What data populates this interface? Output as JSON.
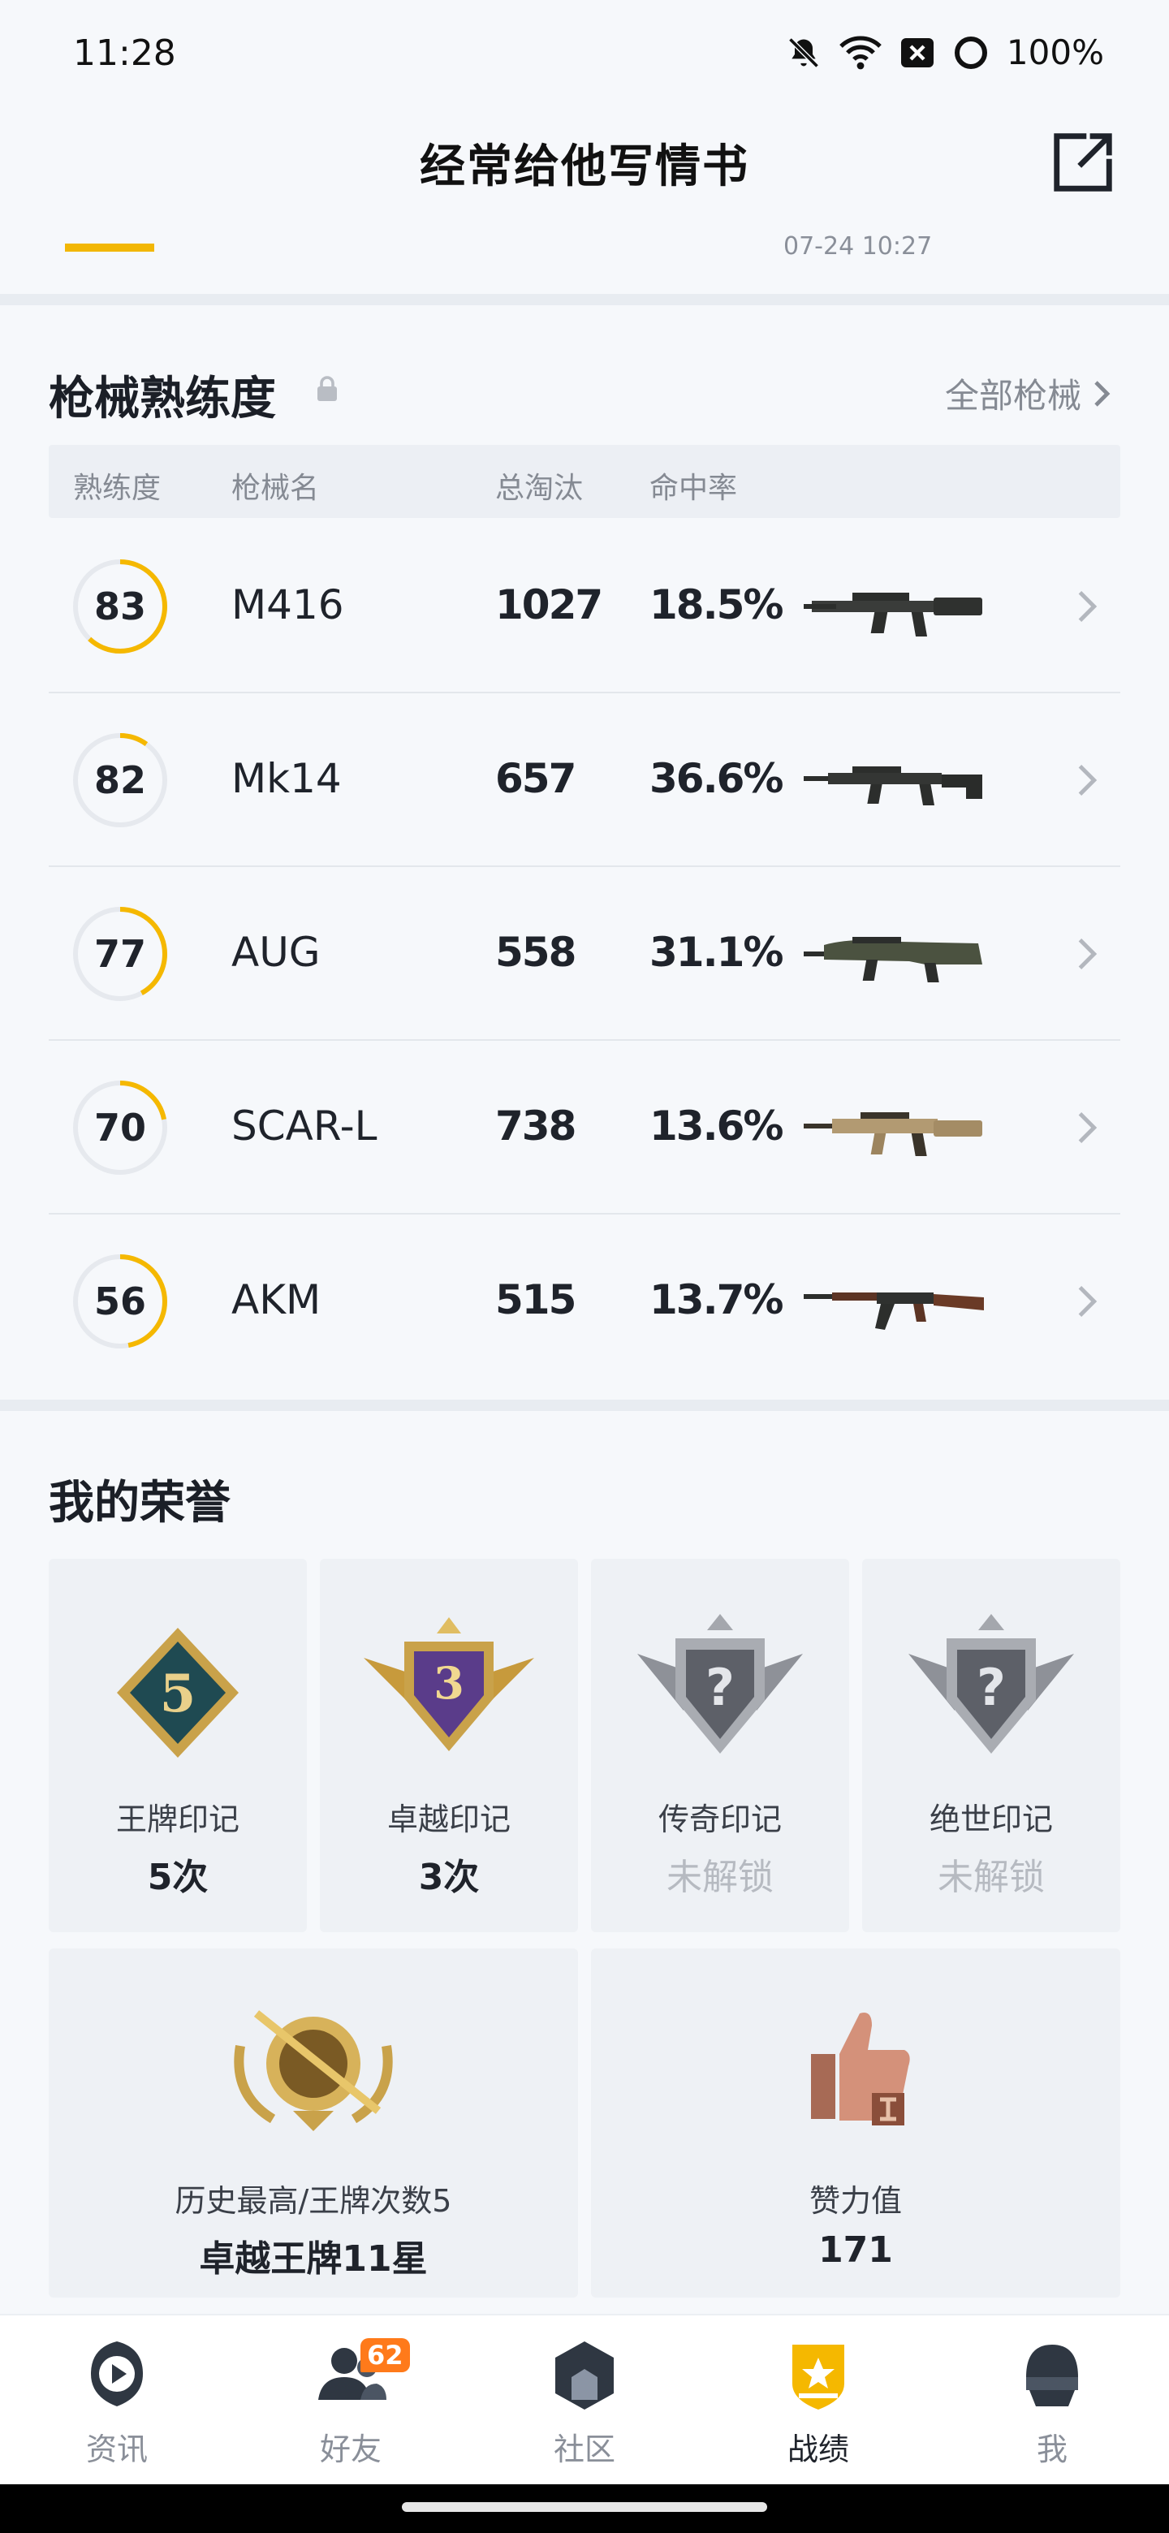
{
  "status_bar": {
    "time": "11:28",
    "battery": "100%"
  },
  "header": {
    "title": "经常给他写情书"
  },
  "top_strip": {
    "timestamp": "07-24 10:27"
  },
  "weapons": {
    "title": "枪械熟练度",
    "all_link": "全部枪械",
    "columns": [
      "熟练度",
      "枪械名",
      "总淘汰",
      "命中率"
    ],
    "rows": [
      {
        "level": "83",
        "progress": 0.62,
        "name": "M416",
        "kills": "1027",
        "rate": "18.5%",
        "gun": "m416-rifle"
      },
      {
        "level": "82",
        "progress": 0.1,
        "name": "Mk14",
        "kills": "657",
        "rate": "36.6%",
        "gun": "mk14-rifle"
      },
      {
        "level": "77",
        "progress": 0.42,
        "name": "AUG",
        "kills": "558",
        "rate": "31.1%",
        "gun": "aug-rifle"
      },
      {
        "level": "70",
        "progress": 0.22,
        "name": "SCAR-L",
        "kills": "738",
        "rate": "13.6%",
        "gun": "scar-l-rifle"
      },
      {
        "level": "56",
        "progress": 0.47,
        "name": "AKM",
        "kills": "515",
        "rate": "13.7%",
        "gun": "akm-rifle"
      }
    ],
    "colors": {
      "ring": "#f5b800",
      "track": "#e6e9ee"
    }
  },
  "honors": {
    "title": "我的荣誉",
    "badges": [
      {
        "label": "王牌印记",
        "value": "5次",
        "badge_text": "5",
        "locked": false
      },
      {
        "label": "卓越印记",
        "value": "3次",
        "badge_text": "3",
        "locked": false
      },
      {
        "label": "传奇印记",
        "value": "未解锁",
        "badge_text": "?",
        "locked": true
      },
      {
        "label": "绝世印记",
        "value": "未解锁",
        "badge_text": "?",
        "locked": true
      }
    ],
    "summary": [
      {
        "label": "历史最高/王牌次数5",
        "value": "卓越王牌11星"
      },
      {
        "label": "赞力值",
        "value": "171"
      }
    ]
  },
  "nav": {
    "items": [
      {
        "label": "资讯",
        "icon": "news-icon",
        "active": false
      },
      {
        "label": "好友",
        "icon": "friends-icon",
        "active": false,
        "badge": "62"
      },
      {
        "label": "社区",
        "icon": "community-icon",
        "active": false
      },
      {
        "label": "战绩",
        "icon": "record-icon",
        "active": true
      },
      {
        "label": "我",
        "icon": "profile-icon",
        "active": false
      }
    ]
  }
}
